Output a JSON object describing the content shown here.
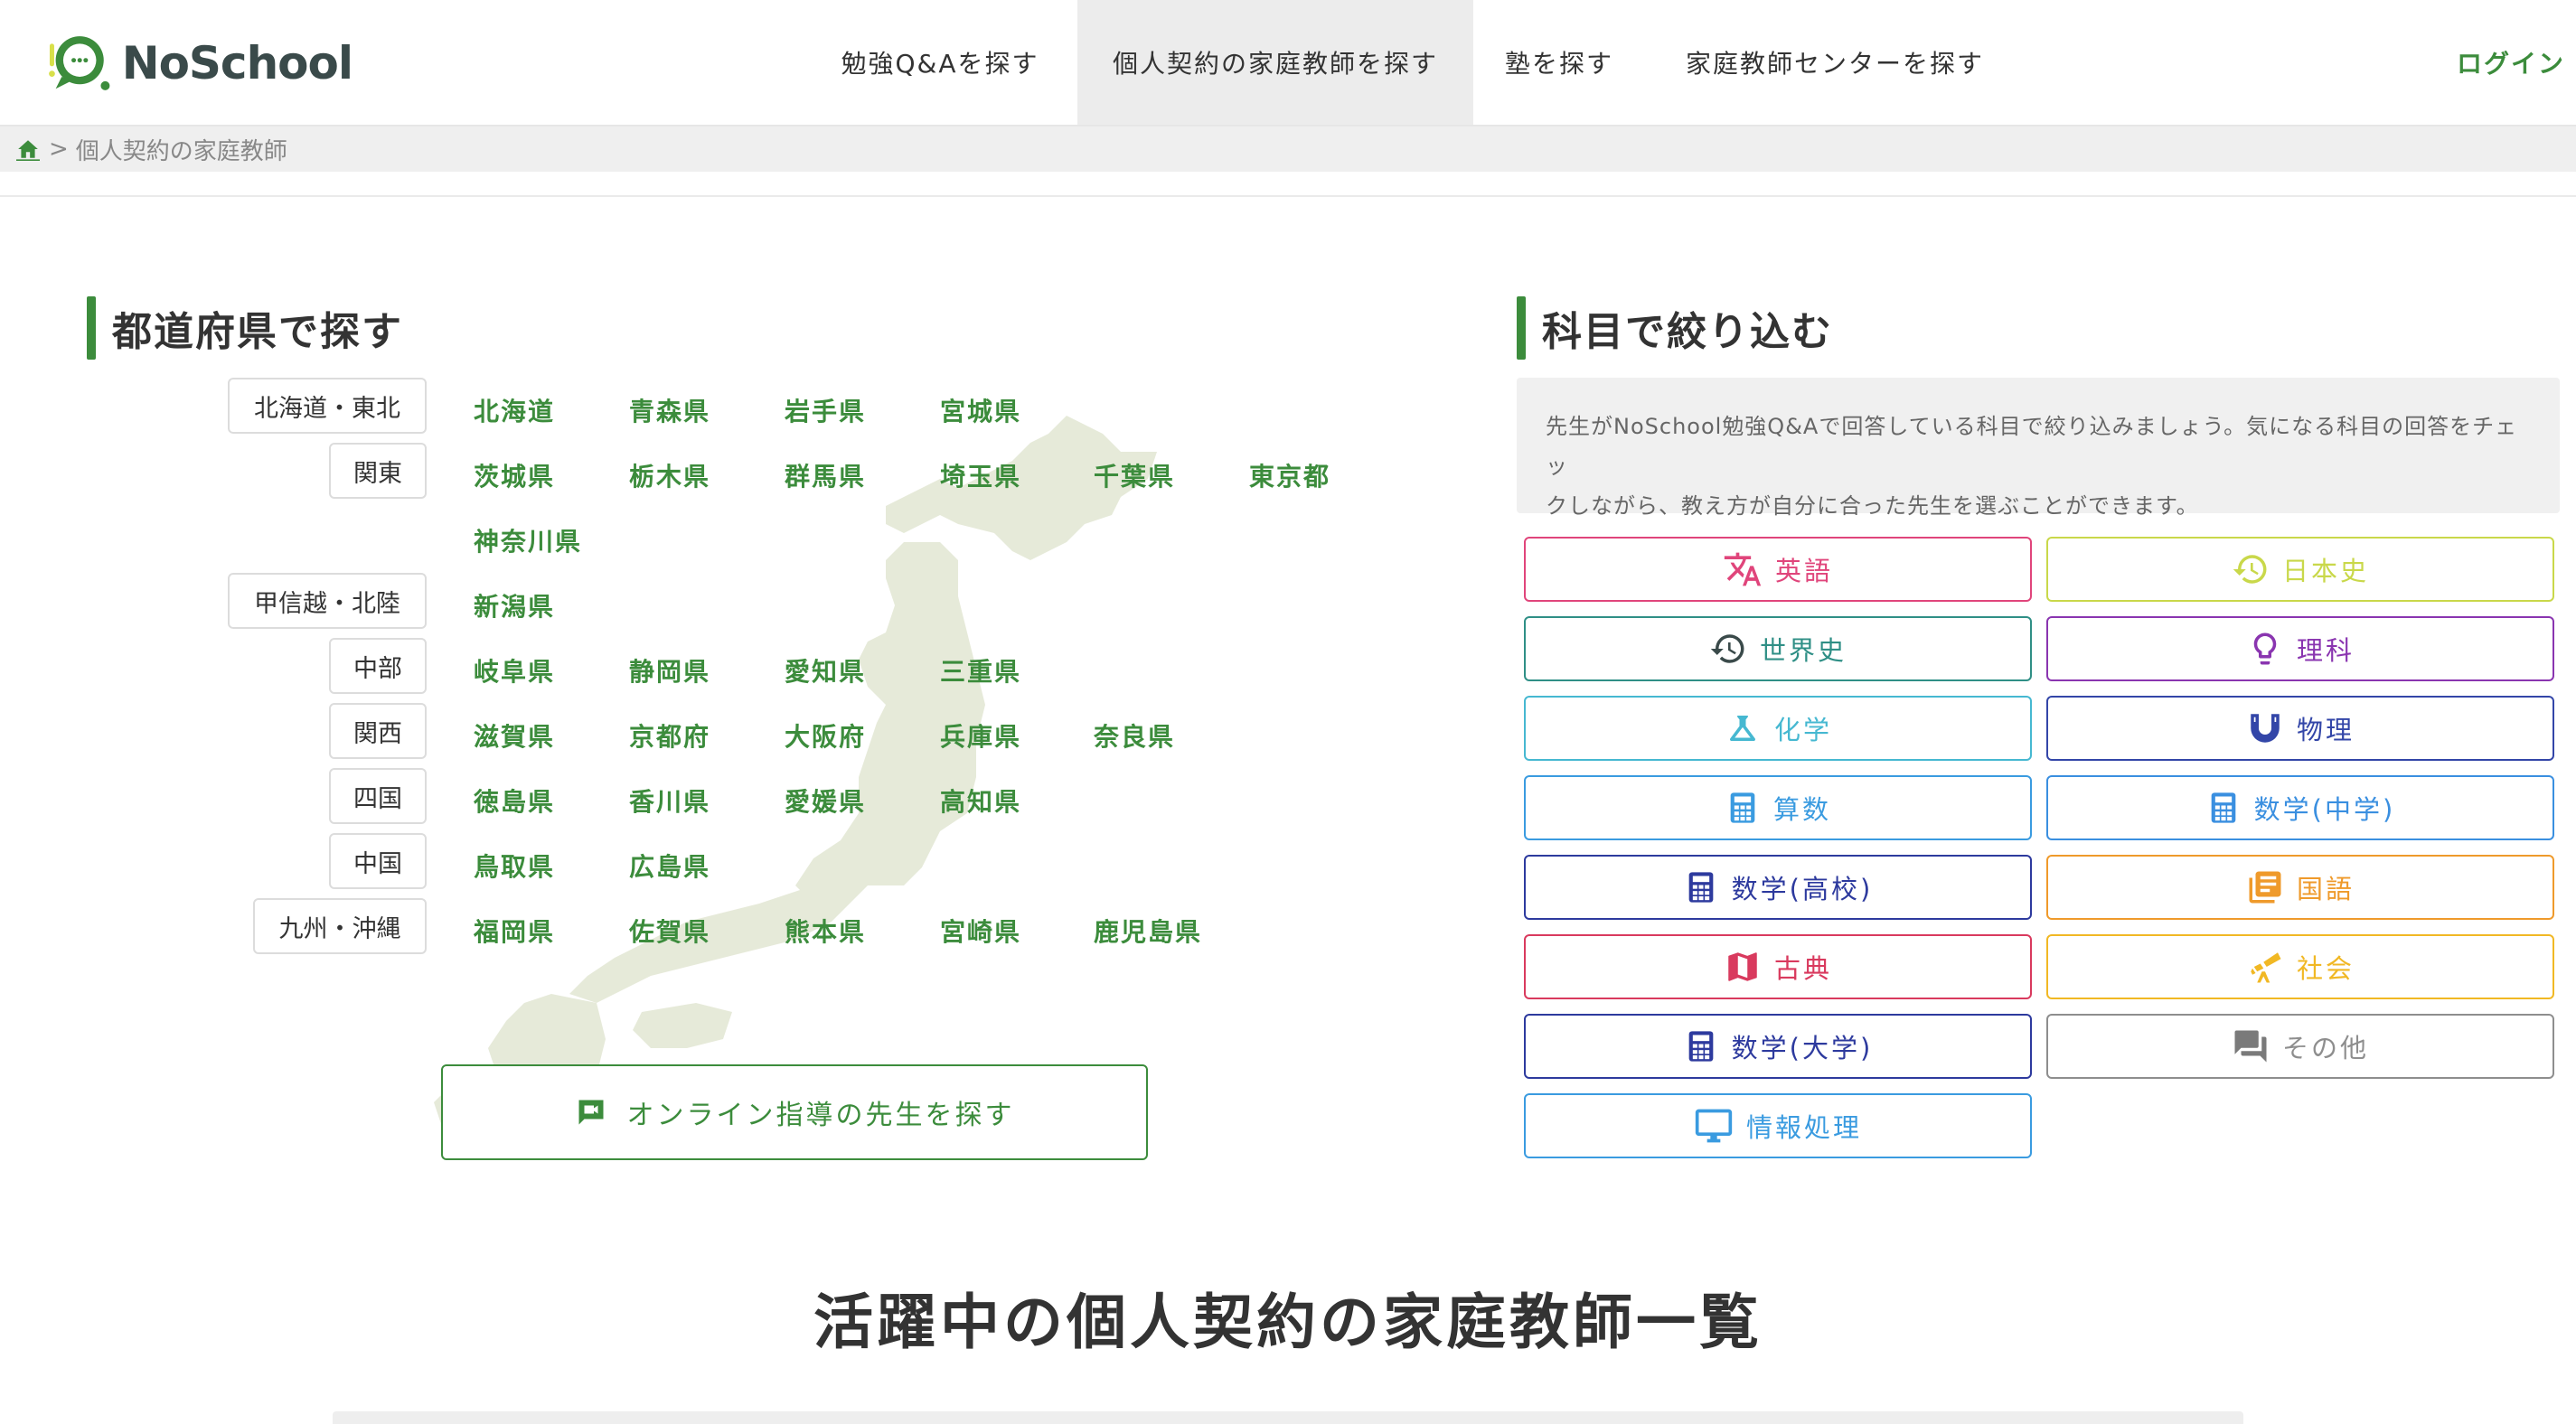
{
  "header": {
    "logo_text": "NoSchool",
    "nav": [
      {
        "label": "勉強Q&Aを探す",
        "active": false
      },
      {
        "label": "個人契約の家庭教師を探す",
        "active": true
      },
      {
        "label": "塾を探す",
        "active": false
      },
      {
        "label": "家庭教師センターを探す",
        "active": false
      }
    ],
    "login_label": "ログイン"
  },
  "breadcrumb": {
    "separator": ">",
    "current": "個人契約の家庭教師"
  },
  "prefecture_section": {
    "title": "都道府県で探す",
    "regions": [
      {
        "label": "北海道・東北",
        "prefectures": [
          "北海道",
          "青森県",
          "岩手県",
          "宮城県"
        ]
      },
      {
        "label": "関東",
        "prefectures": [
          "茨城県",
          "栃木県",
          "群馬県",
          "埼玉県",
          "千葉県",
          "東京都",
          "神奈川県"
        ]
      },
      {
        "label": "甲信越・北陸",
        "prefectures": [
          "新潟県"
        ]
      },
      {
        "label": "中部",
        "prefectures": [
          "岐阜県",
          "静岡県",
          "愛知県",
          "三重県"
        ]
      },
      {
        "label": "関西",
        "prefectures": [
          "滋賀県",
          "京都府",
          "大阪府",
          "兵庫県",
          "奈良県"
        ]
      },
      {
        "label": "四国",
        "prefectures": [
          "徳島県",
          "香川県",
          "愛媛県",
          "高知県"
        ]
      },
      {
        "label": "中国",
        "prefectures": [
          "鳥取県",
          "広島県"
        ]
      },
      {
        "label": "九州・沖縄",
        "prefectures": [
          "福岡県",
          "佐賀県",
          "熊本県",
          "宮崎県",
          "鹿児島県"
        ]
      }
    ],
    "online_button_label": "オンライン指導の先生を探す"
  },
  "subject_section": {
    "title": "科目で絞り込む",
    "description_line1": "先生がNoSchool勉強Q&Aで回答している科目で絞り込みましょう。気になる科目の回答をチェッ",
    "description_line2": "クしながら、教え方が自分に合った先生を選ぶことができます。",
    "subjects": [
      {
        "label": "英語",
        "icon": "translate-icon",
        "color": "#e0457b"
      },
      {
        "label": "日本史",
        "icon": "history-icon",
        "color": "#c9d84a"
      },
      {
        "label": "世界史",
        "icon": "history-icon",
        "color": "#2f8f86"
      },
      {
        "label": "理科",
        "icon": "lightbulb-icon",
        "color": "#8a35b0"
      },
      {
        "label": "化学",
        "icon": "flask-icon",
        "color": "#46b8d1"
      },
      {
        "label": "物理",
        "icon": "magnet-icon",
        "color": "#3346a8"
      },
      {
        "label": "算数",
        "icon": "calculator-icon",
        "color": "#3a9be0"
      },
      {
        "label": "数学(中学)",
        "icon": "calculator-icon",
        "color": "#3a8fe0"
      },
      {
        "label": "数学(高校)",
        "icon": "calculator-icon",
        "color": "#2d3a9e"
      },
      {
        "label": "国語",
        "icon": "book-icon",
        "color": "#ef9a2b"
      },
      {
        "label": "古典",
        "icon": "map-icon",
        "color": "#d93a5e"
      },
      {
        "label": "社会",
        "icon": "telescope-icon",
        "color": "#f1b824"
      },
      {
        "label": "数学(大学)",
        "icon": "calculator-icon",
        "color": "#2d3a9e"
      },
      {
        "label": "その他",
        "icon": "forum-icon",
        "color": "#8e8e8e"
      },
      {
        "label": "情報処理",
        "icon": "monitor-icon",
        "color": "#3a9be0"
      }
    ]
  },
  "list_section": {
    "title": "活躍中の個人契約の家庭教師一覧"
  },
  "colors": {
    "brand_green": "#3c8c3c"
  }
}
